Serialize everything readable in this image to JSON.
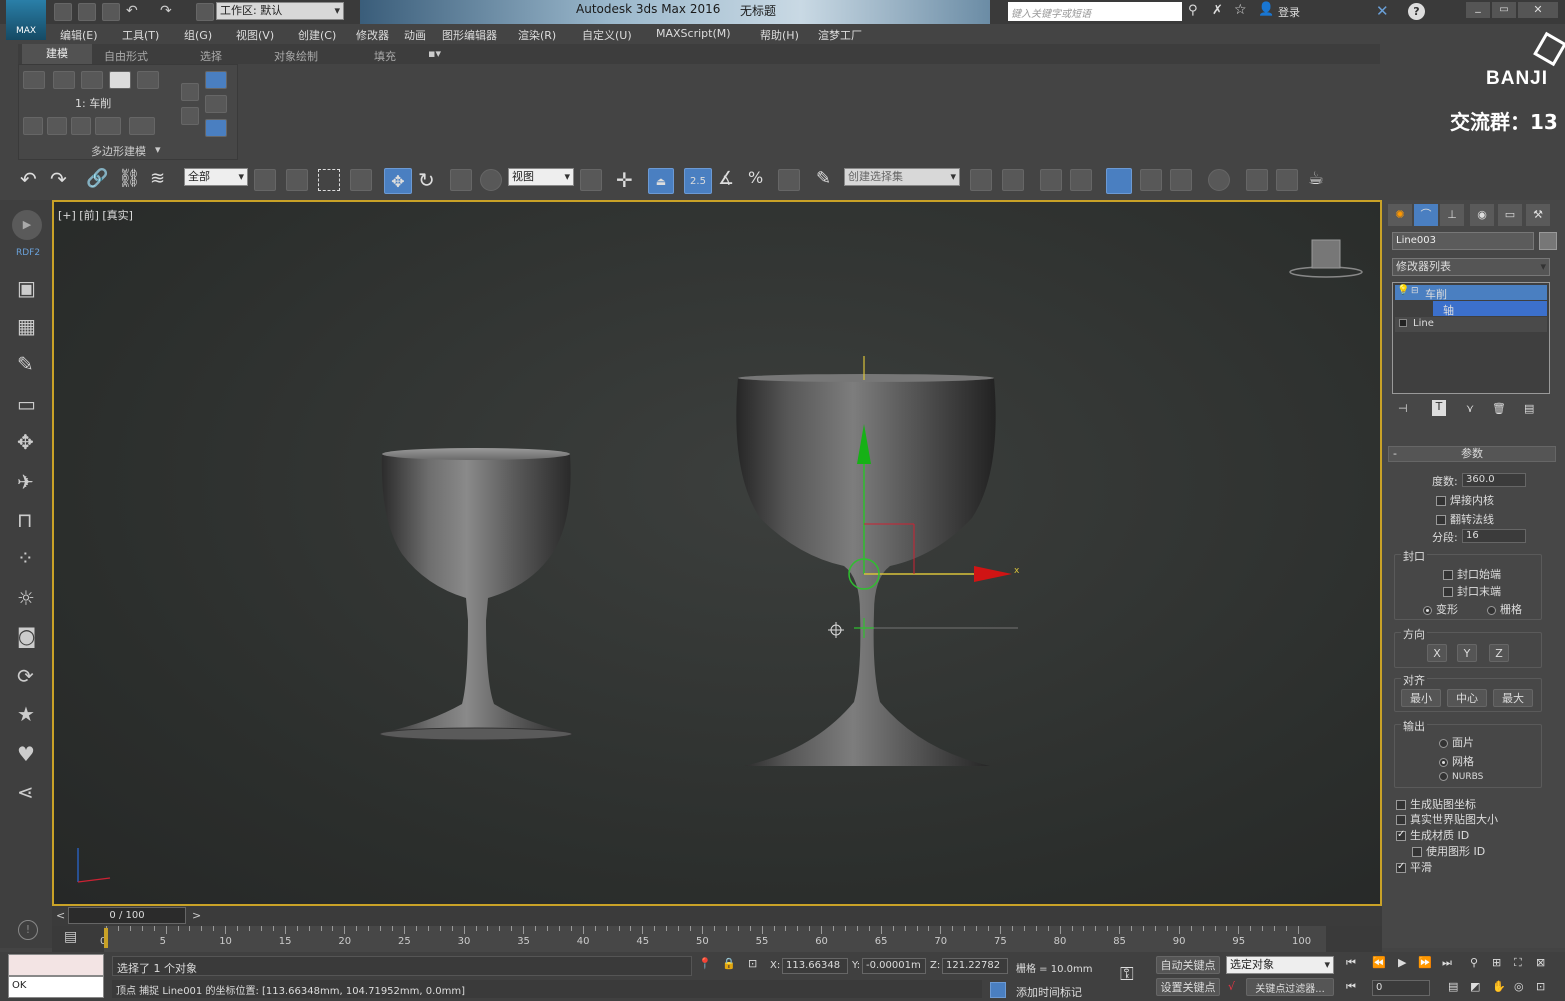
{
  "title_bar": {
    "workspace_label": "工作区: 默认",
    "app_title": "Autodesk 3ds Max 2016",
    "doc_title": "无标题",
    "search_placeholder": "键入关键字或短语",
    "login_label": "登录"
  },
  "menu": [
    "编辑(E)",
    "工具(T)",
    "组(G)",
    "视图(V)",
    "创建(C)",
    "修改器",
    "动画",
    "图形编辑器",
    "渲染(R)",
    "自定义(U)",
    "MAXScript(M)",
    "帮助(H)",
    "渲梦工厂"
  ],
  "ribbon": {
    "tabs": [
      "建模",
      "自由形式",
      "选择",
      "对象绘制",
      "填充"
    ],
    "level_label": "1: 车削",
    "panel_label": "多边形建模"
  },
  "toolbar": {
    "filter_value": "全部",
    "ref_coord_value": "视图",
    "snap_label": "2.5",
    "named_sel_placeholder": "创建选择集"
  },
  "watermark": {
    "brand": "BANJI",
    "group": "交流群：13"
  },
  "left_bar": {
    "label": "RDF2"
  },
  "viewport": {
    "label": "[+] [前] [真实]",
    "gizmo_x_label": "x"
  },
  "command_panel": {
    "object_name": "Line003",
    "modifier_list": "修改器列表",
    "stack": [
      {
        "label": "车削",
        "selected": true
      },
      {
        "label": "轴",
        "selected": true
      },
      {
        "label": "Line",
        "selected": false
      }
    ],
    "params_title": "参数",
    "degrees_label": "度数:",
    "degrees_value": "360.0",
    "weld_core": "焊接内核",
    "flip_normals": "翻转法线",
    "segments_label": "分段:",
    "segments_value": "16",
    "cap_title": "封口",
    "cap_start": "封口始端",
    "cap_end": "封口末端",
    "morph": "变形",
    "grid": "栅格",
    "direction_title": "方向",
    "dir_x": "X",
    "dir_y": "Y",
    "dir_z": "Z",
    "align_title": "对齐",
    "align_min": "最小",
    "align_center": "中心",
    "align_max": "最大",
    "output_title": "输出",
    "out_patch": "面片",
    "out_mesh": "网格",
    "out_nurbs": "NURBS",
    "gen_map_coords": "生成贴图坐标",
    "real_world_map": "真实世界贴图大小",
    "gen_mat_ids": "生成材质 ID",
    "use_shape_ids": "使用图形 ID",
    "smooth": "平滑"
  },
  "timeline": {
    "frame_label": "0 / 100",
    "ticks": [
      "0",
      "5",
      "10",
      "15",
      "20",
      "25",
      "30",
      "35",
      "40",
      "45",
      "50",
      "55",
      "60",
      "65",
      "70",
      "75",
      "80",
      "85",
      "90",
      "95",
      "100"
    ]
  },
  "status": {
    "listener": "OK",
    "selected_msg": "选择了 1 个对象",
    "prompt_msg": "顶点 捕捉 Line001 的坐标位置: [113.66348mm, 104.71952mm, 0.0mm]",
    "x_label": "X:",
    "x_value": "113.66348",
    "y_label": "Y:",
    "y_value": "-0.00001m",
    "z_label": "Z:",
    "z_value": "121.22782",
    "grid_label": "栅格 = 10.0mm",
    "auto_key": "自动关键点",
    "set_key": "设置关键点",
    "selected_obj": "选定对象",
    "key_filters": "关键点过滤器...",
    "add_time_tag": "添加时间标记",
    "frame_value": "0"
  }
}
